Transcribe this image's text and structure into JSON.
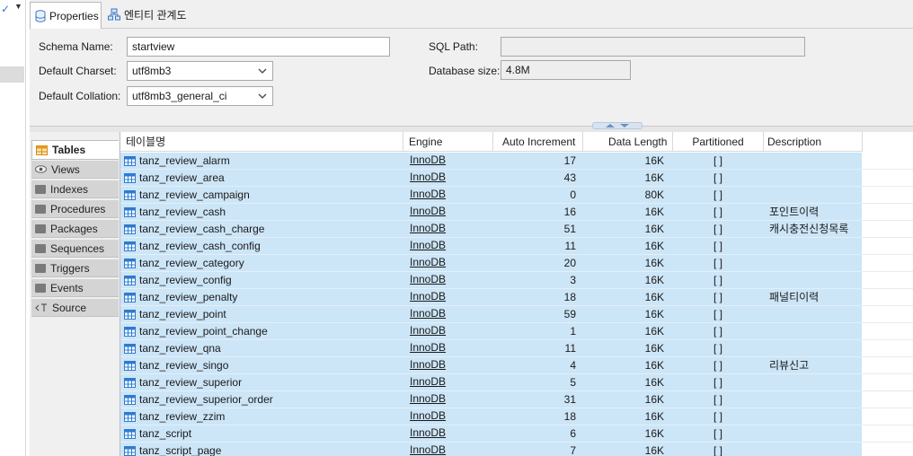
{
  "tabs": [
    {
      "label": "Properties",
      "icon": "database-icon"
    },
    {
      "label": "엔티티 관계도",
      "icon": "er-diagram-icon"
    }
  ],
  "form": {
    "schema_name_label": "Schema Name:",
    "schema_name_value": "startview",
    "default_charset_label": "Default Charset:",
    "default_charset_value": "utf8mb3",
    "default_collation_label": "Default Collation:",
    "default_collation_value": "utf8mb3_general_ci",
    "sql_path_label": "SQL Path:",
    "sql_path_value": "",
    "database_size_label": "Database size:",
    "database_size_value": "4.8M"
  },
  "side_tabs": [
    {
      "label": "Tables",
      "icon": "table-icon",
      "active": true
    },
    {
      "label": "Views",
      "icon": "eye-icon",
      "active": false
    },
    {
      "label": "Indexes",
      "icon": "folder-icon",
      "active": false
    },
    {
      "label": "Procedures",
      "icon": "folder-icon",
      "active": false
    },
    {
      "label": "Packages",
      "icon": "folder-icon",
      "active": false
    },
    {
      "label": "Sequences",
      "icon": "folder-icon",
      "active": false
    },
    {
      "label": "Triggers",
      "icon": "folder-icon",
      "active": false
    },
    {
      "label": "Events",
      "icon": "folder-icon",
      "active": false
    },
    {
      "label": "Source",
      "icon": "source-icon",
      "active": false
    }
  ],
  "table": {
    "columns": [
      "테이블명",
      "Engine",
      "Auto Increment",
      "Data Length",
      "Partitioned",
      "Description"
    ],
    "rows": [
      {
        "name": "tanz_review_alarm",
        "engine": "InnoDB",
        "auto_increment": "17",
        "data_length": "16K",
        "partitioned": "[ ]",
        "description": ""
      },
      {
        "name": "tanz_review_area",
        "engine": "InnoDB",
        "auto_increment": "43",
        "data_length": "16K",
        "partitioned": "[ ]",
        "description": ""
      },
      {
        "name": "tanz_review_campaign",
        "engine": "InnoDB",
        "auto_increment": "0",
        "data_length": "80K",
        "partitioned": "[ ]",
        "description": ""
      },
      {
        "name": "tanz_review_cash",
        "engine": "InnoDB",
        "auto_increment": "16",
        "data_length": "16K",
        "partitioned": "[ ]",
        "description": "포인트이력"
      },
      {
        "name": "tanz_review_cash_charge",
        "engine": "InnoDB",
        "auto_increment": "51",
        "data_length": "16K",
        "partitioned": "[ ]",
        "description": "캐시충전신청목록"
      },
      {
        "name": "tanz_review_cash_config",
        "engine": "InnoDB",
        "auto_increment": "11",
        "data_length": "16K",
        "partitioned": "[ ]",
        "description": ""
      },
      {
        "name": "tanz_review_category",
        "engine": "InnoDB",
        "auto_increment": "20",
        "data_length": "16K",
        "partitioned": "[ ]",
        "description": ""
      },
      {
        "name": "tanz_review_config",
        "engine": "InnoDB",
        "auto_increment": "3",
        "data_length": "16K",
        "partitioned": "[ ]",
        "description": ""
      },
      {
        "name": "tanz_review_penalty",
        "engine": "InnoDB",
        "auto_increment": "18",
        "data_length": "16K",
        "partitioned": "[ ]",
        "description": "패널티이력"
      },
      {
        "name": "tanz_review_point",
        "engine": "InnoDB",
        "auto_increment": "59",
        "data_length": "16K",
        "partitioned": "[ ]",
        "description": ""
      },
      {
        "name": "tanz_review_point_change",
        "engine": "InnoDB",
        "auto_increment": "1",
        "data_length": "16K",
        "partitioned": "[ ]",
        "description": ""
      },
      {
        "name": "tanz_review_qna",
        "engine": "InnoDB",
        "auto_increment": "11",
        "data_length": "16K",
        "partitioned": "[ ]",
        "description": ""
      },
      {
        "name": "tanz_review_singo",
        "engine": "InnoDB",
        "auto_increment": "4",
        "data_length": "16K",
        "partitioned": "[ ]",
        "description": "리뷰신고"
      },
      {
        "name": "tanz_review_superior",
        "engine": "InnoDB",
        "auto_increment": "5",
        "data_length": "16K",
        "partitioned": "[ ]",
        "description": ""
      },
      {
        "name": "tanz_review_superior_order",
        "engine": "InnoDB",
        "auto_increment": "31",
        "data_length": "16K",
        "partitioned": "[ ]",
        "description": ""
      },
      {
        "name": "tanz_review_zzim",
        "engine": "InnoDB",
        "auto_increment": "18",
        "data_length": "16K",
        "partitioned": "[ ]",
        "description": ""
      },
      {
        "name": "tanz_script",
        "engine": "InnoDB",
        "auto_increment": "6",
        "data_length": "16K",
        "partitioned": "[ ]",
        "description": ""
      },
      {
        "name": "tanz_script_page",
        "engine": "InnoDB",
        "auto_increment": "7",
        "data_length": "16K",
        "partitioned": "[ ]",
        "description": ""
      }
    ]
  },
  "colors": {
    "row_selected": "#cce5f7",
    "panel_bg": "#f0f0f0",
    "accent_icon": "#2d7bd0"
  }
}
